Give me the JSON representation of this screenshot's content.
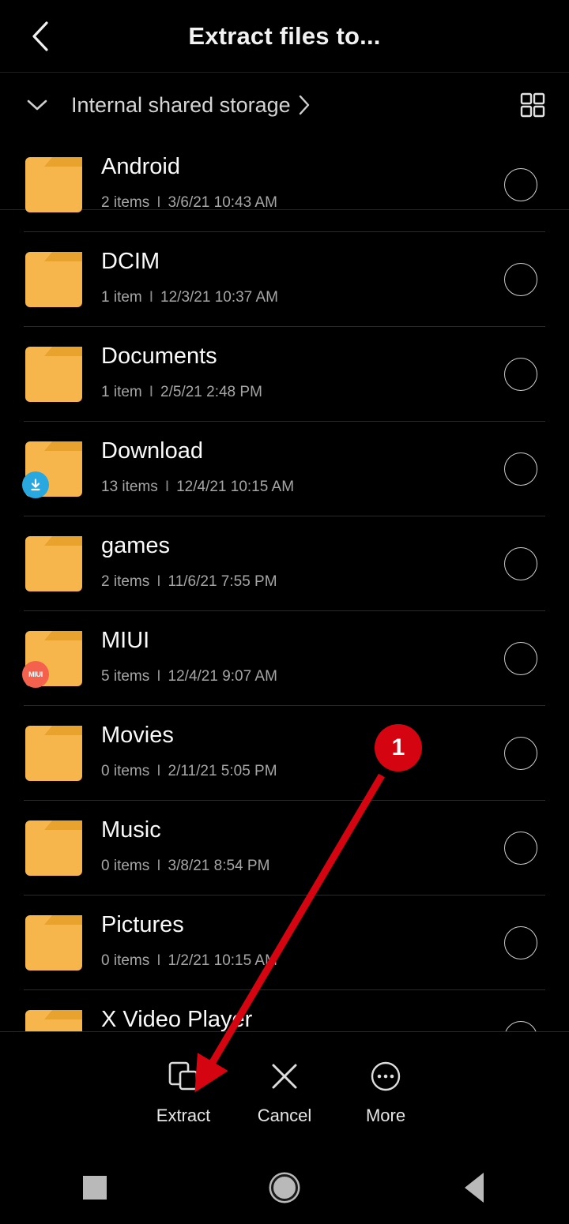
{
  "header": {
    "title": "Extract files to...",
    "back_icon": "chevron-left-icon"
  },
  "breadcrumb": {
    "expand_icon": "chevron-down-icon",
    "path_label": "Internal shared storage",
    "forward_icon": "chevron-right-icon",
    "view_toggle_icon": "grid-view-icon"
  },
  "files": [
    {
      "name": "Android",
      "items": "2 items",
      "date": "3/6/21 10:43 AM",
      "badge": null,
      "selected": false
    },
    {
      "name": "DCIM",
      "items": "1 item",
      "date": "12/3/21 10:37 AM",
      "badge": null,
      "selected": false
    },
    {
      "name": "Documents",
      "items": "1 item",
      "date": "2/5/21 2:48 PM",
      "badge": null,
      "selected": false
    },
    {
      "name": "Download",
      "items": "13 items",
      "date": "12/4/21 10:15 AM",
      "badge": "download",
      "badge_label": "",
      "selected": false
    },
    {
      "name": "games",
      "items": "2 items",
      "date": "11/6/21 7:55 PM",
      "badge": null,
      "selected": false
    },
    {
      "name": "MIUI",
      "items": "5 items",
      "date": "12/4/21 9:07 AM",
      "badge": "miui",
      "badge_label": "MIUI",
      "selected": false
    },
    {
      "name": "Movies",
      "items": "0 items",
      "date": "2/11/21 5:05 PM",
      "badge": null,
      "selected": false
    },
    {
      "name": "Music",
      "items": "0 items",
      "date": "3/8/21 8:54 PM",
      "badge": null,
      "selected": false
    },
    {
      "name": "Pictures",
      "items": "0 items",
      "date": "1/2/21 10:15 AM",
      "badge": null,
      "selected": false
    },
    {
      "name": "X Video Player",
      "items": "",
      "date": "",
      "badge": null,
      "selected": false
    }
  ],
  "meta_separator": "I",
  "actionbar": {
    "items": [
      {
        "label": "Extract",
        "icon": "extract-copy-icon"
      },
      {
        "label": "Cancel",
        "icon": "close-x-icon"
      },
      {
        "label": "More",
        "icon": "more-ellipsis-icon"
      }
    ]
  },
  "navbar": {
    "recents_icon": "recents-square-icon",
    "home_icon": "home-circle-icon",
    "back_icon": "back-triangle-icon"
  },
  "annotation": {
    "step_number": "1",
    "color": "#d40511"
  },
  "colors": {
    "background": "#000000",
    "folder": "#f7b64c",
    "folder_tab": "#e8a22e",
    "accent_download": "#29a8e0",
    "accent_miui": "#f4624e",
    "annotation": "#d40511"
  }
}
